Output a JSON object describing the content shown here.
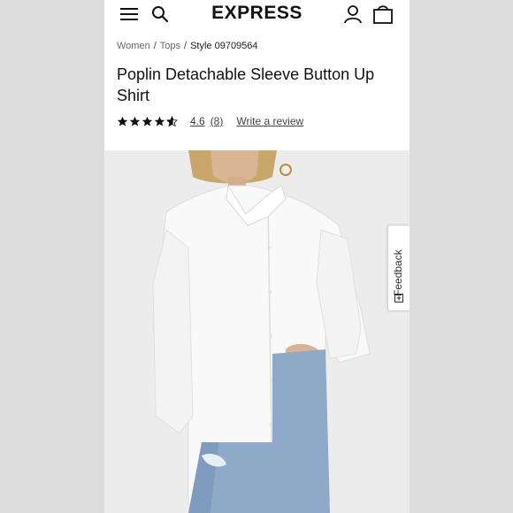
{
  "header": {
    "logo": "EXPRESS",
    "menu_icon": "hamburger-menu-icon",
    "search_icon": "search-icon",
    "account_icon": "account-icon",
    "bag_icon": "shopping-bag-icon"
  },
  "breadcrumb": {
    "items": [
      "Women",
      "Tops"
    ],
    "separator": "/",
    "current": "Style 09709564"
  },
  "product": {
    "title": "Poplin Detachable Sleeve Button Up Shirt",
    "rating": {
      "stars": 4.6,
      "value_text": "4.6",
      "count_text": "(8)",
      "write_review": "Write a review"
    },
    "image_alt_subject": "white poplin shirt on model"
  },
  "feedback": {
    "label": "Feedback",
    "icon": "feedback-icon"
  },
  "colors": {
    "background": "#dcdcdc",
    "page": "#ffffff",
    "text": "#111111",
    "muted": "#666666"
  }
}
